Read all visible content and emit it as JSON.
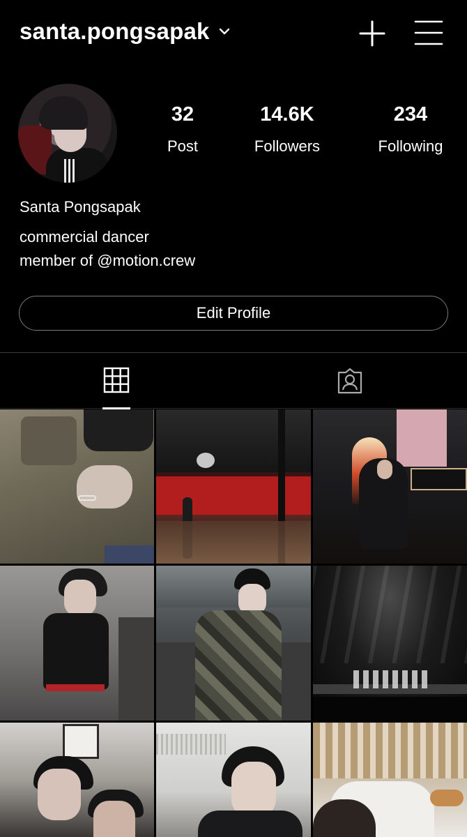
{
  "header": {
    "username": "santa.pongsapak",
    "icons": [
      "chevron-down-icon",
      "plus-icon",
      "menu-icon"
    ]
  },
  "profile": {
    "stats": [
      {
        "value": "32",
        "label": "Post"
      },
      {
        "value": "14.6K",
        "label": "Followers"
      },
      {
        "value": "234",
        "label": "Following"
      }
    ],
    "display_name": "Santa Pongsapak",
    "bio_lines": [
      "commercial dancer",
      "member of @motion.crew"
    ],
    "edit_button_label": "Edit Profile"
  },
  "tabs": [
    {
      "icon": "grid-icon",
      "active": true
    },
    {
      "icon": "tagged-person-icon",
      "active": false
    }
  ],
  "posts_count_visible": 9,
  "colors": {
    "background": "#000000",
    "text": "#ffffff",
    "border": "#7a7a7a"
  }
}
